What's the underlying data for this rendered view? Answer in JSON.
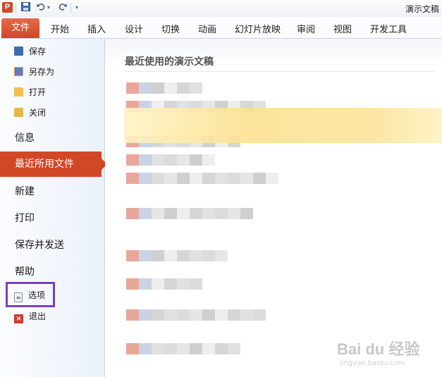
{
  "qat": {
    "app_icon": "P",
    "save_icon": "save-icon",
    "undo_icon": "undo-icon",
    "redo_icon": "redo-icon",
    "window_title": "演示文稿"
  },
  "tabs": {
    "file": "文件",
    "items": [
      "开始",
      "插入",
      "设计",
      "切换",
      "动画",
      "幻灯片放映",
      "审阅",
      "视图",
      "开发工具"
    ]
  },
  "nav": {
    "save": "保存",
    "save_as": "另存为",
    "open": "打开",
    "close": "关闭",
    "info": "信息",
    "recent": "最近所用文件",
    "new": "新建",
    "print": "打印",
    "save_send": "保存并发送",
    "help": "帮助",
    "options": "选项",
    "exit": "退出"
  },
  "main": {
    "recent_title": "最近使用的演示文稿"
  },
  "watermark": {
    "brand": "Bai du 经验",
    "url": "jingyan.baidu.com"
  },
  "colors": {
    "file_tab": "#d24726",
    "highlight": "#7b3fbf"
  }
}
